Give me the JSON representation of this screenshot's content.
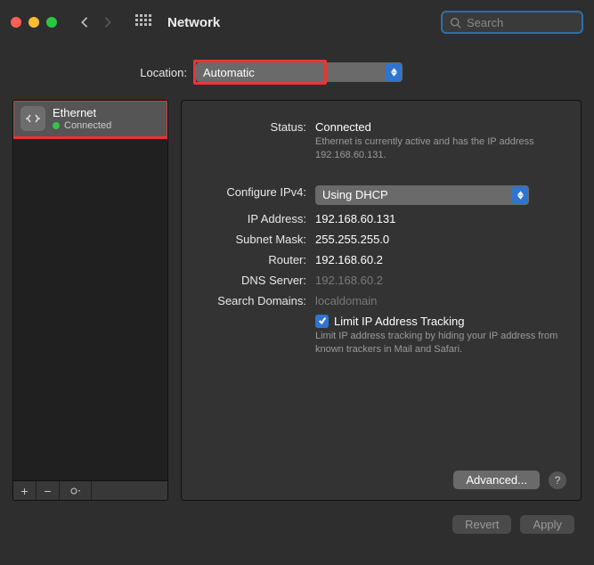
{
  "window": {
    "title": "Network"
  },
  "search": {
    "placeholder": "Search"
  },
  "location": {
    "label": "Location:",
    "value": "Automatic"
  },
  "sidebar": {
    "items": [
      {
        "name": "Ethernet",
        "status": "Connected"
      }
    ]
  },
  "detail": {
    "status_label": "Status:",
    "status_value": "Connected",
    "status_sub": "Ethernet is currently active and has the IP address 192.168.60.131.",
    "configure_label": "Configure IPv4:",
    "configure_value": "Using DHCP",
    "ip_label": "IP Address:",
    "ip_value": "192.168.60.131",
    "mask_label": "Subnet Mask:",
    "mask_value": "255.255.255.0",
    "router_label": "Router:",
    "router_value": "192.168.60.2",
    "dns_label": "DNS Server:",
    "dns_value": "192.168.60.2",
    "search_label": "Search Domains:",
    "search_value": "localdomain",
    "limit_label": "Limit IP Address Tracking",
    "limit_sub": "Limit IP address tracking by hiding your IP address from known trackers in Mail and Safari.",
    "advanced": "Advanced...",
    "help": "?"
  },
  "actions": {
    "revert": "Revert",
    "apply": "Apply"
  }
}
